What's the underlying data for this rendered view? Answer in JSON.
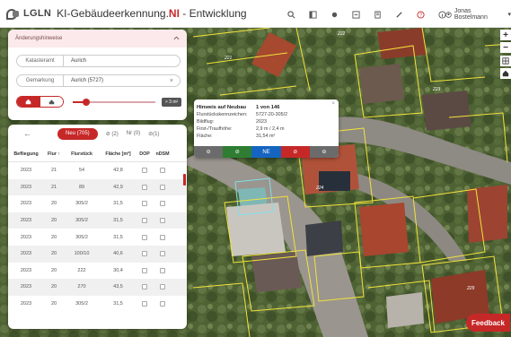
{
  "header": {
    "logo_text": "LGLN",
    "title_main": "KI-Gebäudeerkennung.",
    "title_ni": "NI",
    "title_suffix": " - Entwicklung",
    "user_name": "Jonas Bostelmann"
  },
  "filter": {
    "title": "Änderungshinweise",
    "fields": [
      {
        "label": "Katasteramt",
        "value": "Aurich"
      },
      {
        "label": "Gemarkung",
        "value": "Aurich (5727)"
      }
    ],
    "slider_badge": "> 3 m²"
  },
  "results": {
    "tab_new": "Neu (705)",
    "tab_2": "(2)",
    "tab_3": "Nr (0)",
    "tab_4": "(1)",
    "columns": [
      "Befliegung",
      "Flur ↑",
      "Flurstück",
      "Fläche [m²]",
      "DOP",
      "nDSM"
    ],
    "rows": [
      [
        "2023",
        "21",
        "54",
        "42,8"
      ],
      [
        "2023",
        "21",
        "89",
        "42,9"
      ],
      [
        "2023",
        "20",
        "305/2",
        "31,5"
      ],
      [
        "2023",
        "20",
        "305/2",
        "31,5"
      ],
      [
        "2023",
        "20",
        "305/2",
        "31,5"
      ],
      [
        "2023",
        "20",
        "100/10",
        "40,6"
      ],
      [
        "2023",
        "20",
        "222",
        "30,4"
      ],
      [
        "2023",
        "20",
        "270",
        "43,5"
      ],
      [
        "2023",
        "20",
        "305/2",
        "31,5"
      ]
    ]
  },
  "popup": {
    "title": "Hinweis auf Neubau",
    "count": "1 von 146",
    "rows": [
      {
        "k": "Flurstückskennzeichen:",
        "v": "5727-20-305/2"
      },
      {
        "k": "Bildflug:",
        "v": "2023"
      },
      {
        "k": "First-/Traufhöhe:",
        "v": "2,9 m / 2,4 m"
      },
      {
        "k": "Fläche:",
        "v": "31,54 m²"
      }
    ],
    "btn_ne": "NE",
    "colors": [
      "#6b6b6b",
      "#2e7d32",
      "#1565c0",
      "#c62828",
      "#6b6b6b"
    ]
  },
  "map": {
    "labels": [
      "222",
      "221",
      "223",
      "224",
      "229"
    ]
  },
  "feedback_label": "Feedback"
}
